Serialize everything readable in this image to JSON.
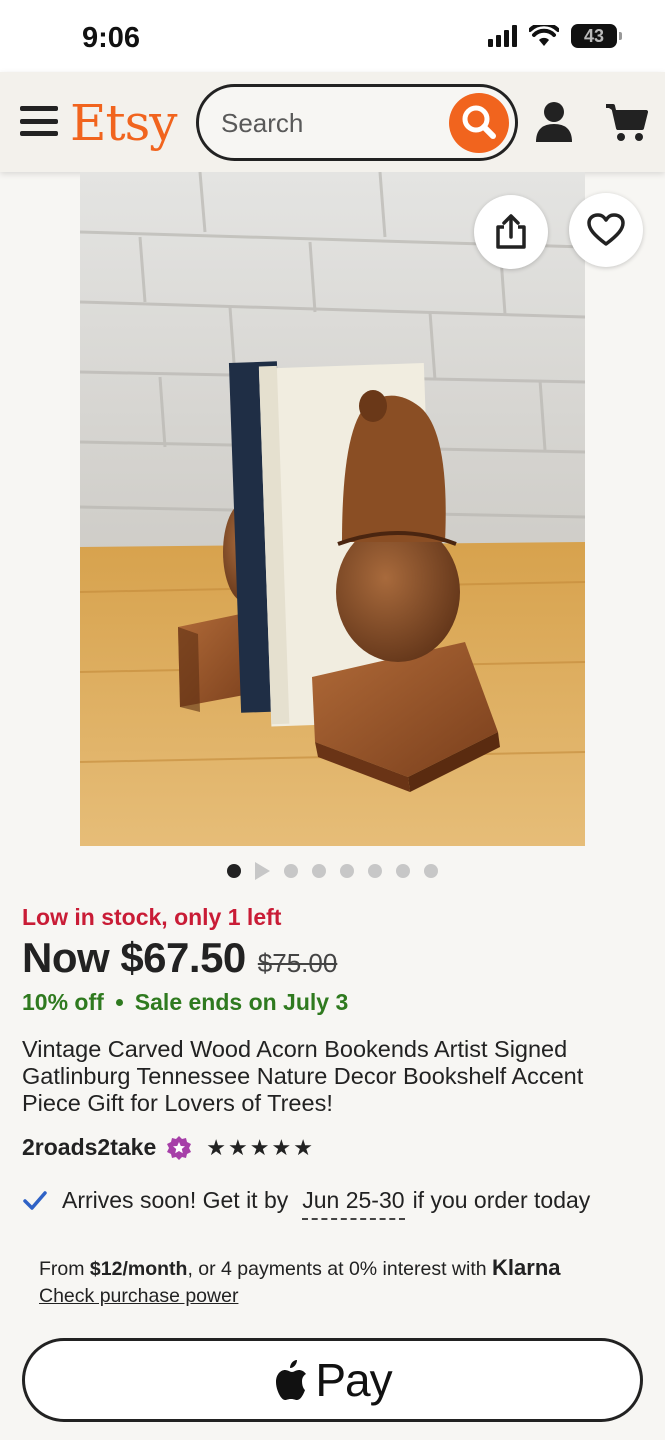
{
  "status_bar": {
    "time": "9:06",
    "battery": "43"
  },
  "header": {
    "logo": "Etsy",
    "search_placeholder": "Search"
  },
  "gallery": {
    "total_images": 8,
    "active_index": 0
  },
  "listing": {
    "stock_notice": "Low in stock, only 1 left",
    "price_now": "Now $67.50",
    "price_original": "$75.00",
    "discount": "10% off",
    "sale_ends": "Sale ends on July 3",
    "title": "Vintage Carved Wood Acorn Bookends Artist Signed Gatlinburg Tennessee Nature Decor Bookshelf Accent Piece Gift for Lovers of Trees!",
    "shop_name": "2roads2take",
    "rating_stars": 5,
    "arrival_prefix": "Arrives soon! Get it by",
    "arrival_dates": "Jun 25-30",
    "arrival_suffix": "if you order today"
  },
  "klarna": {
    "from": "From",
    "monthly": "$12/month",
    "middle": ", or 4 payments at 0% interest with",
    "brand": "Klarna",
    "link": "Check purchase power"
  },
  "apple_pay": {
    "label": "Pay"
  },
  "colors": {
    "brand": "#f1641e",
    "stock": "#c91c36",
    "sale": "#2f7a1f",
    "star_seller": "#a63fa8"
  }
}
